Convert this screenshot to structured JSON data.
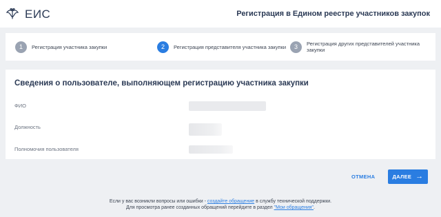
{
  "header": {
    "brand": "ЕИС",
    "page_title": "Регистрация в Едином реестре участников закупок"
  },
  "steps": [
    {
      "number": "1",
      "label": "Регистрация участника закупки",
      "state": "inactive"
    },
    {
      "number": "2",
      "label": "Регистрация представителя участника закупки",
      "state": "active"
    },
    {
      "number": "3",
      "label": "Регистрация других представителей участника закупки",
      "state": "inactive"
    }
  ],
  "card": {
    "title": "Сведения о пользователе, выполняющем регистрацию участника закупки",
    "fields": [
      {
        "label": "ФИО"
      },
      {
        "label": "Должность"
      },
      {
        "label": "Полномочия пользователя"
      }
    ]
  },
  "actions": {
    "cancel": "ОТМЕНА",
    "next": "ДАЛЕЕ"
  },
  "footer": {
    "line1_before": "Если у вас возникли вопросы или ошибки - ",
    "line1_link": "создайте обращение",
    "line1_after": " в службу технической поддержки.",
    "line2_before": "Для просмотра ранее созданных обращений перейдите в раздел ",
    "line2_link": "\"Мои обращения\"",
    "line2_after": "."
  },
  "colors": {
    "accent": "#2a7de1",
    "step_inactive": "#9aa3b2",
    "title": "#2b3a55",
    "background": "#eef0f3"
  }
}
